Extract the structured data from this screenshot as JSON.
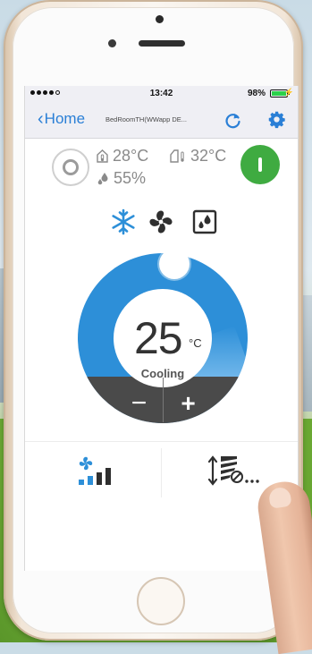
{
  "status_bar": {
    "time": "13:42",
    "battery": "98%",
    "battery_level": 0.98
  },
  "nav": {
    "back_label": "Home",
    "device_name": "BedRoomTH(WWapp DE..."
  },
  "sensors": {
    "indoor_temp": "28°C",
    "outdoor_temp": "32°C",
    "humidity": "55%"
  },
  "modes": [
    {
      "name": "cooling",
      "icon": "snowflake-icon",
      "active": true
    },
    {
      "name": "fan",
      "icon": "fan-icon",
      "active": false
    },
    {
      "name": "dry",
      "icon": "humidity-icon",
      "active": false
    }
  ],
  "thermostat": {
    "set_temperature": "25",
    "unit": "°C",
    "mode_label": "Cooling",
    "minus_label": "−",
    "plus_label": "+"
  },
  "controls": {
    "fan_speed_icon": "fan-speed-icon",
    "swing_icon": "swing-icon"
  },
  "colors": {
    "accent_blue": "#2d8fd8",
    "nav_blue": "#2a7fd6",
    "power_green": "#3fab41",
    "dial_dark": "#4a4a4a"
  }
}
